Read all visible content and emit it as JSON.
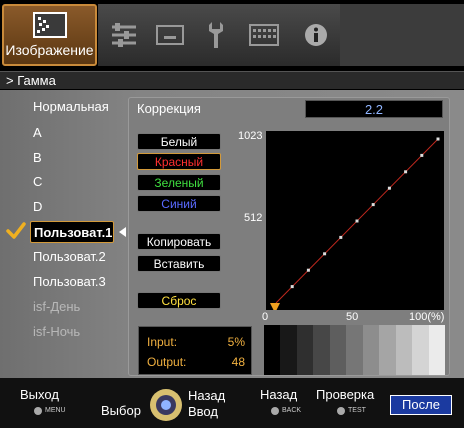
{
  "topbar": {
    "tabs": [
      {
        "label": "Изображение",
        "icon": "picture-icon",
        "selected": true
      },
      {
        "icon": "settings-sliders-icon"
      },
      {
        "icon": "input-screen-icon"
      },
      {
        "icon": "wrench-icon"
      },
      {
        "icon": "keyboard-icon"
      },
      {
        "icon": "info-icon"
      }
    ]
  },
  "title": "> Гамма",
  "modes": [
    {
      "label": "Нормальная"
    },
    {
      "label": "A"
    },
    {
      "label": "B"
    },
    {
      "label": "C"
    },
    {
      "label": "D"
    },
    {
      "label": "Пользоват.1",
      "selected": true
    },
    {
      "label": "Пользоват.2"
    },
    {
      "label": "Пользоват.3"
    },
    {
      "label": "isf-День",
      "disabled": true
    },
    {
      "label": "isf-Ночь",
      "disabled": true
    }
  ],
  "correction": {
    "label": "Коррекция",
    "value": "2.2"
  },
  "color_buttons": [
    {
      "label": "Белый",
      "color": "#ffffff"
    },
    {
      "label": "Красный",
      "color": "#ff3030",
      "active": true
    },
    {
      "label": "Зеленый",
      "color": "#40e040"
    },
    {
      "label": "Синий",
      "color": "#5a6aff"
    }
  ],
  "action_buttons": {
    "copy": "Копировать",
    "paste": "Вставить",
    "reset": "Сброс",
    "reset_color": "#ffe040"
  },
  "graph": {
    "y_ticks": [
      "1023",
      "512"
    ],
    "x_ticks": [
      "0",
      "50",
      "100(%)"
    ],
    "points": [
      0,
      10,
      20,
      30,
      40,
      50,
      60,
      70,
      80,
      90,
      100
    ],
    "line_color": "#c0281e",
    "handle_color": "#f0a020"
  },
  "readout": {
    "input_label": "Input:",
    "input_value": "5%",
    "output_label": "Output:",
    "output_value": "48"
  },
  "footer": {
    "exit": "Выход",
    "exit_key": "MENU",
    "select": "Выбор",
    "back_top": "Назад",
    "enter": "Ввод",
    "back": "Назад",
    "back_key": "BACK",
    "check": "Проверка",
    "check_key": "TEST",
    "after": "После"
  }
}
